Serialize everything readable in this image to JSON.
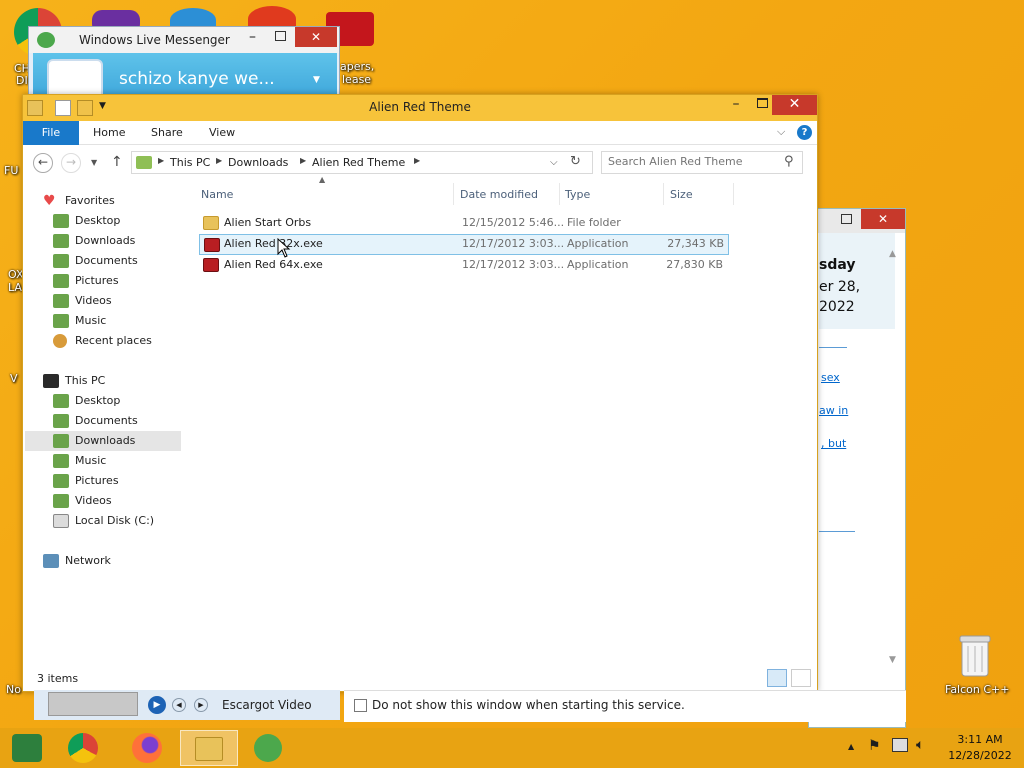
{
  "desktop": {
    "icons_text": [
      {
        "name": "chrome-shortcut",
        "text": "CH"
      },
      {
        "name": "cut-text-1",
        "text": "DI"
      },
      {
        "name": "paint-text",
        "text": "FU"
      },
      {
        "name": "left-text-3",
        "text": "OX"
      },
      {
        "name": "left-text-4",
        "text": "LA"
      },
      {
        "name": "left-text-5",
        "text": "V"
      },
      {
        "name": "left-text-6",
        "text": "No"
      },
      {
        "name": "wallpaper-text-1",
        "text": "apers,"
      },
      {
        "name": "wallpaper-text-2",
        "text": "lease"
      }
    ],
    "recycle_bin_label": "Falcon C++"
  },
  "messenger": {
    "title": "Windows Live Messenger",
    "display_name": "schizo kanye we..."
  },
  "background_window": {
    "day": "sday",
    "date_line1": "er 28,",
    "date_line2": "2022",
    "links": [
      "sex",
      "aw in",
      ", but"
    ]
  },
  "explorer": {
    "title": "Alien Red Theme",
    "tabs": {
      "file": "File",
      "home": "Home",
      "share": "Share",
      "view": "View"
    },
    "breadcrumb": [
      "This PC",
      "Downloads",
      "Alien Red Theme"
    ],
    "search_placeholder": "Search Alien Red Theme",
    "nav": {
      "favorites": "Favorites",
      "fav_items": [
        "Desktop",
        "Downloads",
        "Documents",
        "Pictures",
        "Videos",
        "Music",
        "Recent places"
      ],
      "this_pc": "This PC",
      "pc_items": [
        "Desktop",
        "Documents",
        "Downloads",
        "Music",
        "Pictures",
        "Videos",
        "Local Disk (C:)"
      ],
      "network": "Network"
    },
    "columns": {
      "name": "Name",
      "date": "Date modified",
      "type": "Type",
      "size": "Size"
    },
    "files": [
      {
        "name": "Alien Start Orbs",
        "date": "12/15/2012 5:46...",
        "type": "File folder",
        "size": ""
      },
      {
        "name": "Alien Red 32x.exe",
        "date": "12/17/2012 3:03...",
        "type": "Application",
        "size": "27,343 KB"
      },
      {
        "name": "Alien Red 64x.exe",
        "date": "12/17/2012 3:03...",
        "type": "Application",
        "size": "27,830 KB"
      }
    ],
    "status": "3 items"
  },
  "video_strip": {
    "label": "Escargot Video"
  },
  "dialog_strip": {
    "checkbox_label": "Do not show this window when starting this service."
  },
  "taskbar": {
    "time": "3:11 AM",
    "date": "12/28/2022"
  },
  "colors": {
    "accent": "#1979ca",
    "titlebar": "#f7c33a",
    "close": "#c7392b",
    "desktop": "#f3a712"
  }
}
